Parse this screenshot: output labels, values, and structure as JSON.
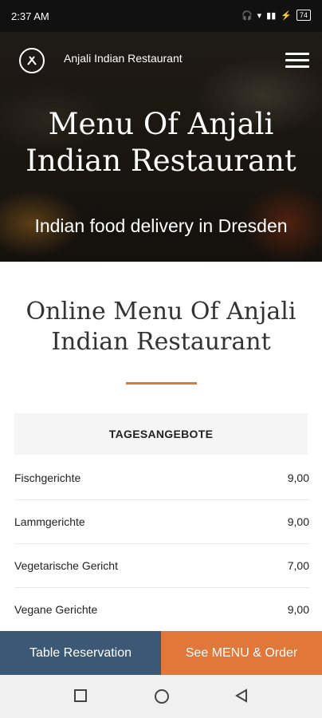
{
  "status": {
    "time": "2:37 AM",
    "battery": "74"
  },
  "header": {
    "brand": "Anjali Indian Restaurant"
  },
  "hero": {
    "title": "Menu Of Anjali Indian Restaurant",
    "subtitle": "Indian food delivery in Dresden"
  },
  "section": {
    "title": "Online Menu Of Anjali Indian Restaurant",
    "tab": "TAGESANGEBOTE"
  },
  "menu_items": [
    {
      "name": "Fischgerichte",
      "price": "9,00"
    },
    {
      "name": "Lammgerichte",
      "price": "9,00"
    },
    {
      "name": "Vegetarische Gericht",
      "price": "7,00"
    },
    {
      "name": "Vegane Gerichte",
      "price": "9,00"
    }
  ],
  "cta": {
    "reservation": "Table Reservation",
    "order": "See MENU & Order"
  },
  "colors": {
    "accent": "#e07a30",
    "reservation_bg": "#3b5874",
    "order_bg": "#e1783a"
  }
}
